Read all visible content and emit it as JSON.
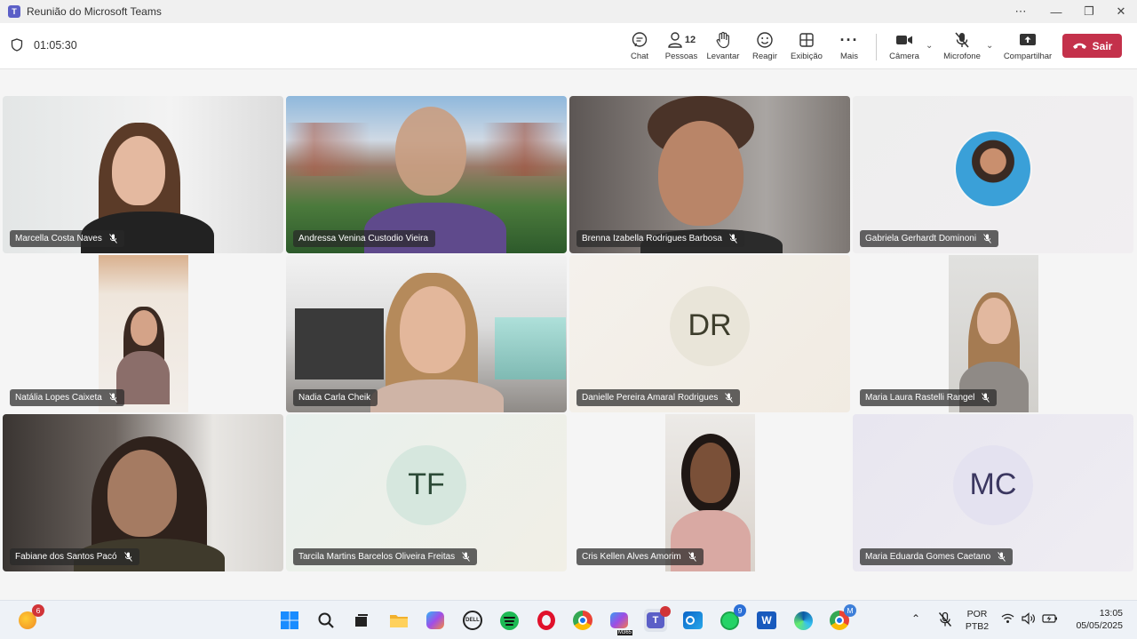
{
  "window": {
    "title": "Reunião do Microsoft Teams"
  },
  "meeting": {
    "timer": "01:05:30",
    "toolbar": {
      "chat": "Chat",
      "people": "Pessoas",
      "people_count": "12",
      "raise": "Levantar",
      "react": "Reagir",
      "view": "Exibição",
      "more": "Mais",
      "camera": "Câmera",
      "mic": "Microfone",
      "share": "Compartilhar",
      "leave": "Sair"
    }
  },
  "participants": [
    {
      "name": "Marcella Costa Naves",
      "muted": true,
      "type": "video"
    },
    {
      "name": "Andressa Venina Custodio Vieira",
      "muted": false,
      "type": "video"
    },
    {
      "name": "Brenna Izabella Rodrigues Barbosa",
      "muted": true,
      "type": "video"
    },
    {
      "name": "Gabriela Gerhardt Dominoni",
      "muted": true,
      "type": "photo"
    },
    {
      "name": "Natália Lopes Caixeta",
      "muted": true,
      "type": "video"
    },
    {
      "name": "Nadia Carla Cheik",
      "muted": false,
      "type": "video"
    },
    {
      "name": "Danielle Pereira Amaral Rodrigues",
      "muted": true,
      "type": "initials",
      "initials": "DR"
    },
    {
      "name": "Maria Laura Rastelli Rangel",
      "muted": true,
      "type": "video"
    },
    {
      "name": "Fabiane dos Santos Pacó",
      "muted": true,
      "type": "video"
    },
    {
      "name": "Tarcila Martins Barcelos Oliveira Freitas",
      "muted": true,
      "type": "initials",
      "initials": "TF"
    },
    {
      "name": "Cris Kellen Alves Amorim",
      "muted": true,
      "type": "video"
    },
    {
      "name": "Maria Eduarda Gomes Caetano",
      "muted": true,
      "type": "initials",
      "initials": "MC"
    }
  ],
  "taskbar": {
    "weather_badge": "6",
    "whatsapp_badge": "9",
    "edge_badge": "M",
    "m365_label": "M365",
    "dell_label": "DELL",
    "lang_1": "POR",
    "lang_2": "PTB2",
    "time": "13:05",
    "date": "05/05/2025"
  },
  "colors": {
    "leave": "#c4314b",
    "teams": "#5b5fc7",
    "initials_tf_bg": "#d6e7de",
    "initials_mc_bg": "#e4e2f0"
  }
}
